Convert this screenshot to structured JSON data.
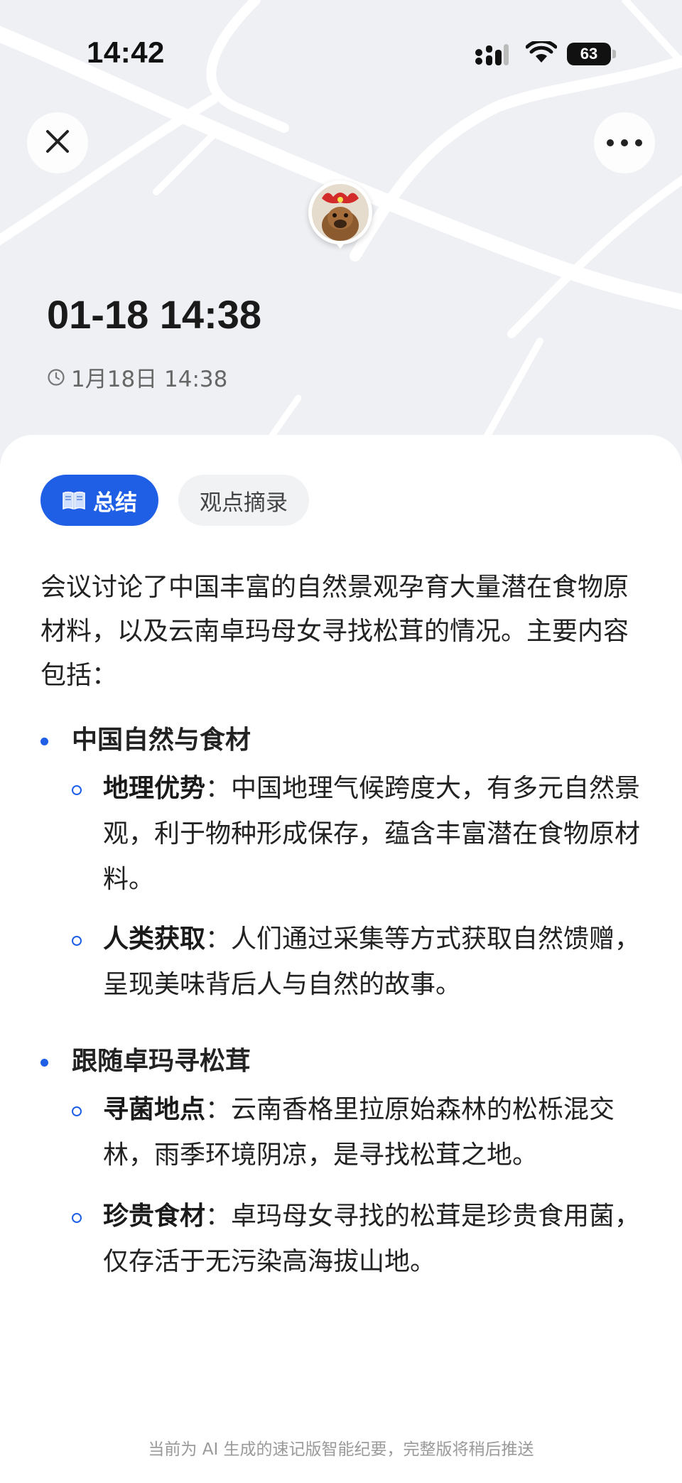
{
  "status_bar": {
    "time": "14:42",
    "battery": "63",
    "icons": [
      "signal-icon",
      "wifi-icon",
      "battery-icon"
    ]
  },
  "header": {
    "close_icon": "close-icon",
    "more_icon": "more-icon",
    "title": "01-18 14:38",
    "subtitle_time": "1月18日 14:38"
  },
  "tabs": [
    {
      "label": "总结",
      "active": true,
      "icon": "book-icon"
    },
    {
      "label": "观点摘录",
      "active": false
    }
  ],
  "summary": {
    "intro": "会议讨论了中国丰富的自然景观孕育大量潜在食物原材料，以及云南卓玛母女寻找松茸的情况。主要内容包括："
  },
  "sections": [
    {
      "title": "中国自然与食材",
      "items": [
        {
          "label": "地理优势",
          "text": "：中国地理气候跨度大，有多元自然景观，利于物种形成保存，蕴含丰富潜在食物原材料。"
        },
        {
          "label": "人类获取",
          "text": "：人们通过采集等方式获取自然馈赠，呈现美味背后人与自然的故事。"
        }
      ]
    },
    {
      "title": "跟随卓玛寻松茸",
      "items": [
        {
          "label": "寻菌地点",
          "text": "：云南香格里拉原始森林的松栎混交林，雨季环境阴凉，是寻找松茸之地。"
        },
        {
          "label": "珍贵食材",
          "text": "：卓玛母女寻找的松茸是珍贵食用菌，仅存活于无污染高海拔山地。"
        }
      ]
    }
  ],
  "footer": {
    "note": "当前为 AI 生成的速记版智能纪要，完整版将稍后推送"
  },
  "colors": {
    "accent": "#1f5fe6",
    "map_bg": "#eef0f3"
  }
}
